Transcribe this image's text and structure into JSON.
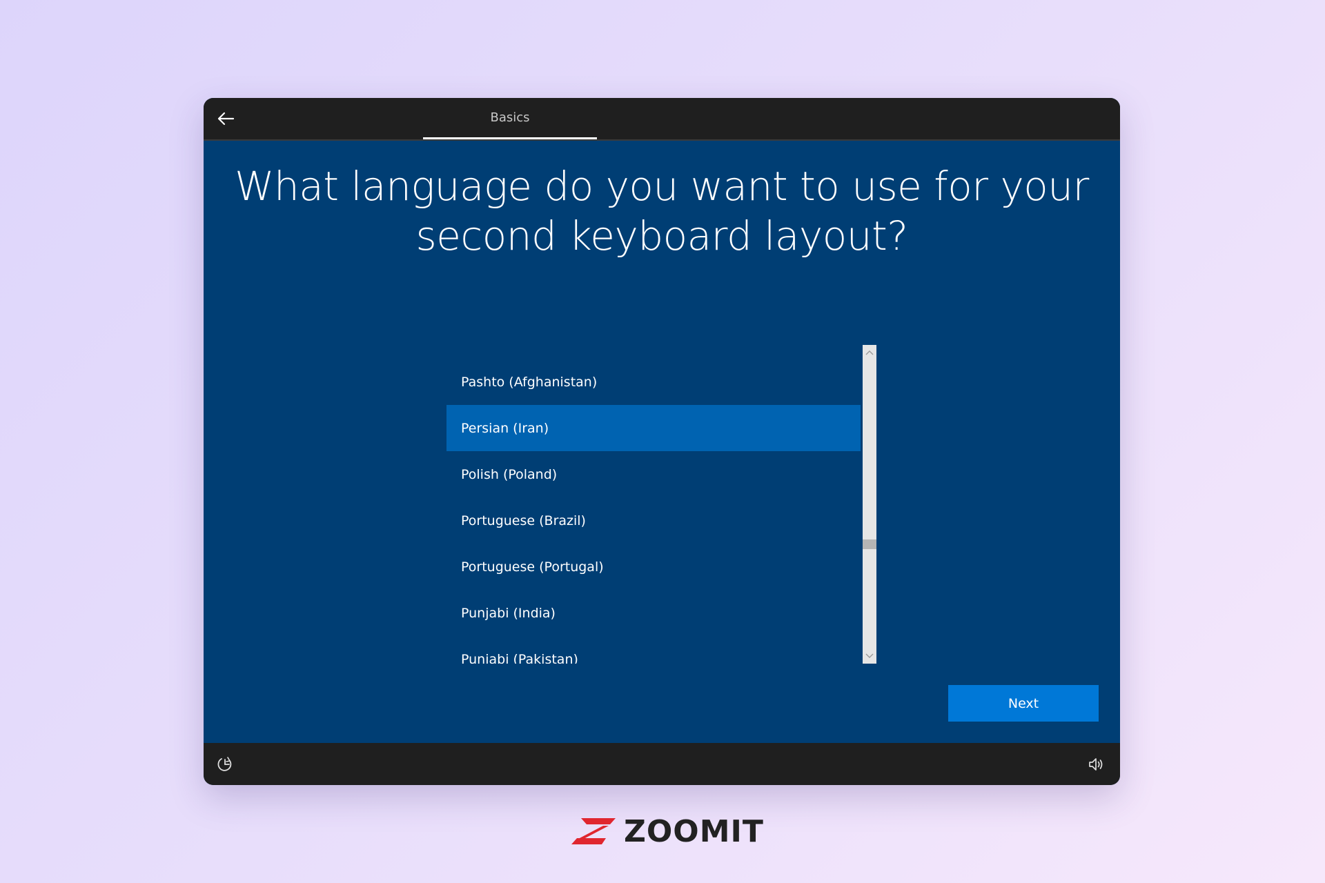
{
  "header": {
    "tab_label": "Basics"
  },
  "main": {
    "title_line1": "What language do you want to use for your",
    "title_line2": "second keyboard layout?",
    "languages": [
      {
        "label": "Pashto (Afghanistan)",
        "selected": false
      },
      {
        "label": "Persian (Iran)",
        "selected": true
      },
      {
        "label": "Polish (Poland)",
        "selected": false
      },
      {
        "label": "Portuguese (Brazil)",
        "selected": false
      },
      {
        "label": "Portuguese (Portugal)",
        "selected": false
      },
      {
        "label": "Punjabi (India)",
        "selected": false
      },
      {
        "label": "Punjabi (Pakistan)",
        "selected": false
      }
    ],
    "next_label": "Next"
  },
  "footer": {
    "left_icon": "ease-of-access-icon",
    "right_icon": "volume-icon"
  },
  "branding": {
    "logo_text": "ZOOMIT",
    "logo_color": "#e0262f"
  },
  "colors": {
    "window_bg": "#003e74",
    "bar_bg": "#1f1f1f",
    "selected_bg": "#0063b1",
    "button_bg": "#0078d7"
  }
}
